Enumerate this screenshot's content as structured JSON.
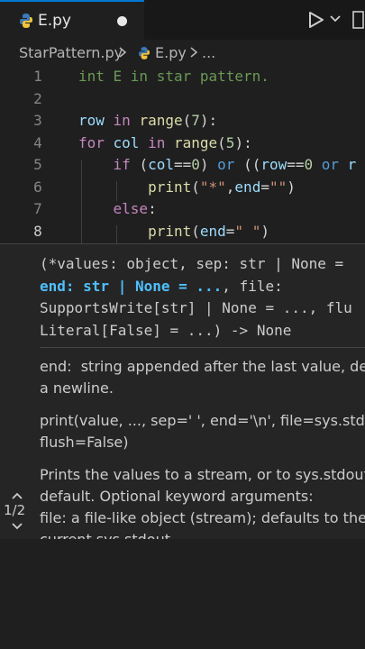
{
  "tab": {
    "filename": "E.py"
  },
  "breadcrumb": {
    "folder": "StarPattern.py",
    "file": "E.py",
    "more": "..."
  },
  "editor": {
    "lines": [
      {
        "n": "1",
        "tokens": [
          {
            "t": "int E in star pattern.",
            "c": "cm"
          }
        ]
      },
      {
        "n": "2",
        "tokens": []
      },
      {
        "n": "3",
        "tokens": [
          {
            "t": "row",
            "c": "var"
          },
          {
            "t": " in ",
            "c": "kw"
          },
          {
            "t": "range",
            "c": "fn"
          },
          {
            "t": "(",
            "c": "op"
          },
          {
            "t": "7",
            "c": "num"
          },
          {
            "t": "):",
            "c": "op"
          }
        ]
      },
      {
        "n": "4",
        "tokens": [
          {
            "t": "for",
            "c": "kw"
          },
          {
            "t": " col ",
            "c": "var"
          },
          {
            "t": "in ",
            "c": "kw"
          },
          {
            "t": "range",
            "c": "fn"
          },
          {
            "t": "(",
            "c": "op"
          },
          {
            "t": "5",
            "c": "num"
          },
          {
            "t": "):",
            "c": "op"
          }
        ]
      },
      {
        "n": "5",
        "tokens": [
          {
            "t": "    if ",
            "c": "kw"
          },
          {
            "t": "(",
            "c": "op"
          },
          {
            "t": "col",
            "c": "var"
          },
          {
            "t": "==",
            "c": "op"
          },
          {
            "t": "0",
            "c": "num"
          },
          {
            "t": ") ",
            "c": "op"
          },
          {
            "t": "or ",
            "c": "ctl"
          },
          {
            "t": "((",
            "c": "op"
          },
          {
            "t": "row",
            "c": "var"
          },
          {
            "t": "==",
            "c": "op"
          },
          {
            "t": "0 ",
            "c": "num"
          },
          {
            "t": "or ",
            "c": "ctl"
          },
          {
            "t": "r",
            "c": "var"
          }
        ]
      },
      {
        "n": "6",
        "tokens": [
          {
            "t": "        print",
            "c": "fn"
          },
          {
            "t": "(",
            "c": "op"
          },
          {
            "t": "\"*\"",
            "c": "str"
          },
          {
            "t": ",",
            "c": "op"
          },
          {
            "t": "end",
            "c": "var"
          },
          {
            "t": "=",
            "c": "op"
          },
          {
            "t": "\"\"",
            "c": "str"
          },
          {
            "t": ")",
            "c": "op"
          }
        ]
      },
      {
        "n": "7",
        "tokens": [
          {
            "t": "    else",
            "c": "kw"
          },
          {
            "t": ":",
            "c": "op"
          }
        ]
      },
      {
        "n": "8",
        "tokens": [
          {
            "t": "        print",
            "c": "fn"
          },
          {
            "t": "(",
            "c": "op"
          },
          {
            "t": "end",
            "c": "var"
          },
          {
            "t": "=",
            "c": "op"
          },
          {
            "t": "\" \"",
            "c": "str"
          },
          {
            "t": ")",
            "c": "op"
          }
        ]
      }
    ],
    "current_line": "8"
  },
  "hover": {
    "signature": {
      "line1": "(*values: object, sep: str | None =",
      "line2_hl": "end: str | None = ...",
      "line2_rest": ", file:",
      "line3": "SupportsWrite[str] | None = ..., flu",
      "line4": "Literal[False] = ...) -> None"
    },
    "param_doc": "end:  string appended after the last value, de\na newline.",
    "usage": "print(value, ..., sep=' ', end='\\n', file=sys.stdou\nflush=False)",
    "description": "Prints the values to a stream, or to sys.stdout\ndefault. Optional keyword arguments:\nfile: a file-like object (stream); defaults to the\ncurrent sys.stdout.",
    "overload_counter": "1/2"
  },
  "colors": {
    "accent": "#0078d4",
    "background": "#1f1f1f",
    "hover_bg": "#252526"
  },
  "icons": [
    "python-file-icon",
    "unsaved-dot-icon",
    "run-icon",
    "chevron-down-icon",
    "chevron-right-icon",
    "chevron-up-icon"
  ]
}
